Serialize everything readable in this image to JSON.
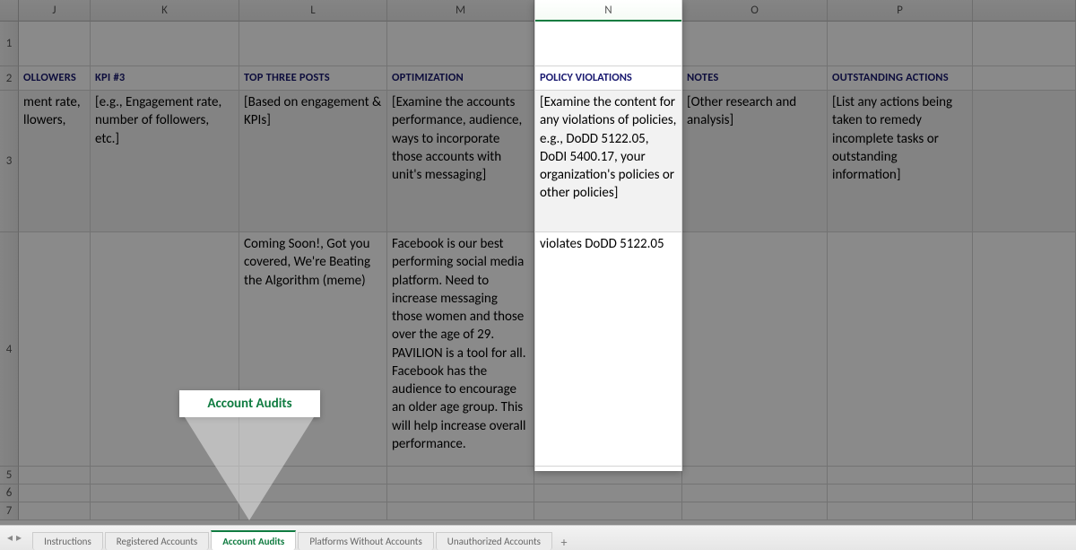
{
  "columns": {
    "J": "J",
    "K": "K",
    "L": "L",
    "M": "M",
    "N": "N",
    "O": "O",
    "P": "P",
    "Q": ""
  },
  "rownums": {
    "r1": "1",
    "r2": "2",
    "r3": "3",
    "r4": "4",
    "r5": "5",
    "r6": "6",
    "r7": "7"
  },
  "headers": {
    "J": "OLLOWERS",
    "K": "KPI #3",
    "L": "TOP THREE POSTS",
    "M": "OPTIMIZATION",
    "N": "POLICY VIOLATIONS",
    "O": "NOTES",
    "P": "OUTSTANDING ACTIONS"
  },
  "row3": {
    "J": "ment rate, llowers,",
    "K": "[e.g., Engagement rate, number of followers, etc.]",
    "L": "[Based on engagement & KPIs]",
    "M": "[Examine the accounts performance, audience, ways to incorporate those accounts with unit's messaging]",
    "N": "[Examine the content for any violations of policies, e.g., DoDD 5122.05, DoDI 5400.17, your organization's policies or other policies]",
    "O": "[Other research and analysis]",
    "P": "[List any actions being taken to remedy incomplete tasks or outstanding information]"
  },
  "row4": {
    "J": "",
    "K": "",
    "L": "Coming Soon!, Got you covered, We're Beating the Algorithm (meme)",
    "M": "Facebook is our best performing social media platform. Need to increase messaging those women and those over the age of 29. PAVILION is a tool for all. Facebook has the audience to encourage an older age group. This will help increase overall performance.",
    "N": "violates DoDD 5122.05",
    "O": "",
    "P": ""
  },
  "callout": {
    "label": "Account Audits"
  },
  "tabs": {
    "items": [
      {
        "label": "Instructions"
      },
      {
        "label": "Registered Accounts"
      },
      {
        "label": "Account Audits"
      },
      {
        "label": "Platforms Without Accounts"
      },
      {
        "label": "Unauthorized Accounts"
      }
    ],
    "nav_prev": "◂",
    "nav_next": "▸",
    "add": "+"
  }
}
